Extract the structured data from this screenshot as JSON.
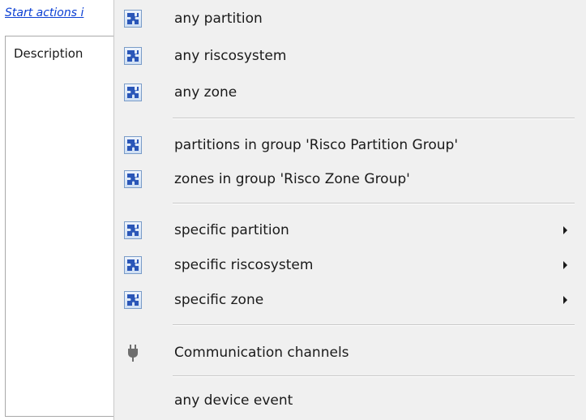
{
  "background": {
    "link_text": "Start actions i",
    "panel_label": "Description"
  },
  "menu": {
    "groups": [
      {
        "items": [
          {
            "label": "any partition",
            "icon": "puzzle-icon",
            "submenu": false
          },
          {
            "label": "any riscosystem",
            "icon": "puzzle-icon",
            "submenu": false
          },
          {
            "label": "any zone",
            "icon": "puzzle-icon",
            "submenu": false
          }
        ]
      },
      {
        "items": [
          {
            "label": "partitions in group 'Risco Partition Group'",
            "icon": "puzzle-icon",
            "submenu": false
          },
          {
            "label": "zones in group 'Risco Zone Group'",
            "icon": "puzzle-icon",
            "submenu": false
          }
        ]
      },
      {
        "items": [
          {
            "label": "specific partition",
            "icon": "puzzle-icon",
            "submenu": true
          },
          {
            "label": "specific riscosystem",
            "icon": "puzzle-icon",
            "submenu": true
          },
          {
            "label": "specific zone",
            "icon": "puzzle-icon",
            "submenu": true
          }
        ]
      },
      {
        "items": [
          {
            "label": "Communication channels",
            "icon": "plug-icon",
            "submenu": false
          }
        ]
      },
      {
        "items": [
          {
            "label": "any device event",
            "icon": "",
            "submenu": false
          }
        ]
      }
    ]
  },
  "colors": {
    "menu_background": "#f0f0f0",
    "link": "#0b3fd4",
    "puzzle_icon": "#2a56b8"
  }
}
